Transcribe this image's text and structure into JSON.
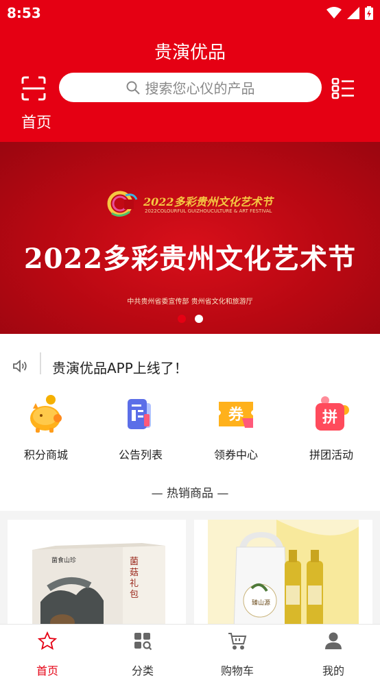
{
  "status_bar": {
    "time": "8:53"
  },
  "header": {
    "title": "贵演优品",
    "search_placeholder": "搜索您心仪的产品",
    "location_tab": "首页"
  },
  "banner": {
    "logo_text": "2022多彩贵州文化艺术节",
    "logo_subtitle": "2022COLOURFUL GUIZHOUCULTURE & ART FESTIVAL",
    "title": "2022多彩贵州文化艺术节",
    "sponsors": "中共贵州省委宣传部  贵州省文化和旅游厅",
    "active_slide": 1,
    "slide_count": 2
  },
  "notice": {
    "text": "贵演优品APP上线了！"
  },
  "quick_menu": [
    {
      "label": "积分商城",
      "icon": "piggy-bank-icon"
    },
    {
      "label": "公告列表",
      "icon": "notice-list-icon"
    },
    {
      "label": "领券中心",
      "icon": "coupon-icon",
      "badge": "券"
    },
    {
      "label": "拼团活动",
      "icon": "group-buy-icon",
      "badge": "拼"
    }
  ],
  "hot_section": {
    "title": "— 热销商品 —"
  },
  "products": [
    {
      "box_label": "菌菇礼包",
      "brand": "菌食山珍"
    },
    {
      "box_label": "臻山源"
    }
  ],
  "tabbar": [
    {
      "label": "首页",
      "icon": "star-icon",
      "active": true
    },
    {
      "label": "分类",
      "icon": "category-icon",
      "active": false
    },
    {
      "label": "购物车",
      "icon": "cart-icon",
      "active": false
    },
    {
      "label": "我的",
      "icon": "user-icon",
      "active": false
    }
  ],
  "colors": {
    "brand_red": "#e50013",
    "text": "#222222"
  }
}
